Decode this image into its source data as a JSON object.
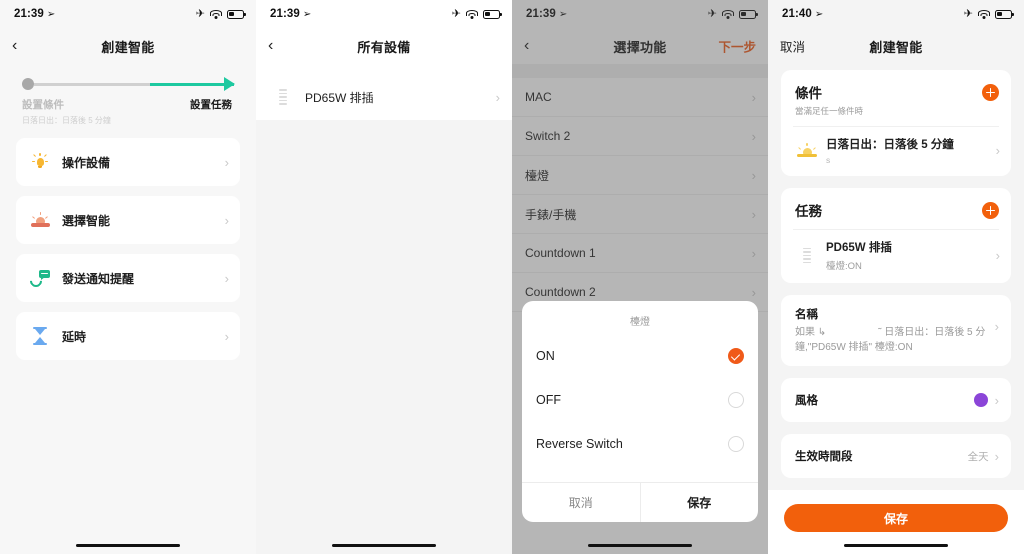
{
  "panels": [
    {
      "statusbar": {
        "time": "21:39",
        "location_icon": "location-arrow-icon",
        "airplane_icon": "airplane-icon",
        "wifi_icon": "wifi-icon",
        "battery_icon": "battery-icon"
      },
      "nav": {
        "back_icon": "chevron-left-icon",
        "title": "創建智能"
      },
      "stepper": {
        "step1_label": "設置條件",
        "step1_sub": "日落日出：日落後 5 分鐘",
        "step2_label": "設置任務"
      },
      "items": [
        {
          "label": "操作設備",
          "icon": "lightbulb-icon",
          "chevron": "chevron-right-icon"
        },
        {
          "label": "選擇智能",
          "icon": "sunset-icon",
          "chevron": "chevron-right-icon"
        },
        {
          "label": "發送通知提醒",
          "icon": "phone-message-icon",
          "chevron": "chevron-right-icon"
        },
        {
          "label": "延時",
          "icon": "hourglass-icon",
          "chevron": "chevron-right-icon"
        }
      ]
    },
    {
      "statusbar": {
        "time": "21:39"
      },
      "nav": {
        "back_icon": "chevron-left-icon",
        "title": "所有設備"
      },
      "devices": [
        {
          "name": "PD65W 排插",
          "icon": "power-strip-icon",
          "chevron": "chevron-right-icon"
        }
      ]
    },
    {
      "statusbar": {
        "time": "21:39"
      },
      "nav": {
        "back_icon": "chevron-left-icon",
        "title": "選擇功能",
        "next_label": "下一步"
      },
      "functions": [
        {
          "label": "MAC"
        },
        {
          "label": "Switch 2"
        },
        {
          "label": "檯燈"
        },
        {
          "label": "手錶/手機"
        },
        {
          "label": "Countdown 1"
        },
        {
          "label": "Countdown 2"
        }
      ],
      "modal": {
        "title": "檯燈",
        "options": [
          {
            "label": "ON",
            "selected": true
          },
          {
            "label": "OFF",
            "selected": false
          },
          {
            "label": "Reverse Switch",
            "selected": false
          }
        ],
        "cancel_label": "取消",
        "save_label": "保存"
      }
    },
    {
      "statusbar": {
        "time": "21:40"
      },
      "nav": {
        "cancel_label": "取消",
        "title": "創建智能"
      },
      "condition_card": {
        "title": "條件",
        "subtitle": "當滿足任一條件時",
        "add_icon": "plus-circle-icon",
        "row": {
          "title": "日落日出：日落後 5 分鐘",
          "sub": "s",
          "icon": "sunrise-icon",
          "chevron": "chevron-right-icon"
        }
      },
      "task_card": {
        "title": "任務",
        "add_icon": "plus-circle-icon",
        "row": {
          "title": "PD65W 排插",
          "sub": "檯燈:ON",
          "icon": "power-strip-icon",
          "chevron": "chevron-right-icon"
        }
      },
      "name_card": {
        "title": "名稱",
        "value_prefix": "如果 ↳",
        "value_suffix": "˜ 日落日出：日落後 5 分鐘,\"PD65W 排插\" 檯燈:ON",
        "chevron": "chevron-right-icon"
      },
      "style_row": {
        "label": "風格",
        "color": "#8b45d8",
        "chevron": "chevron-right-icon"
      },
      "time_row": {
        "label": "生效時間段",
        "value": "全天",
        "chevron": "chevron-right-icon"
      },
      "save_label": "保存"
    }
  ],
  "colors": {
    "accent_orange": "#f2600c",
    "accent_green": "#1ec9a0",
    "style_purple": "#8b45d8"
  }
}
